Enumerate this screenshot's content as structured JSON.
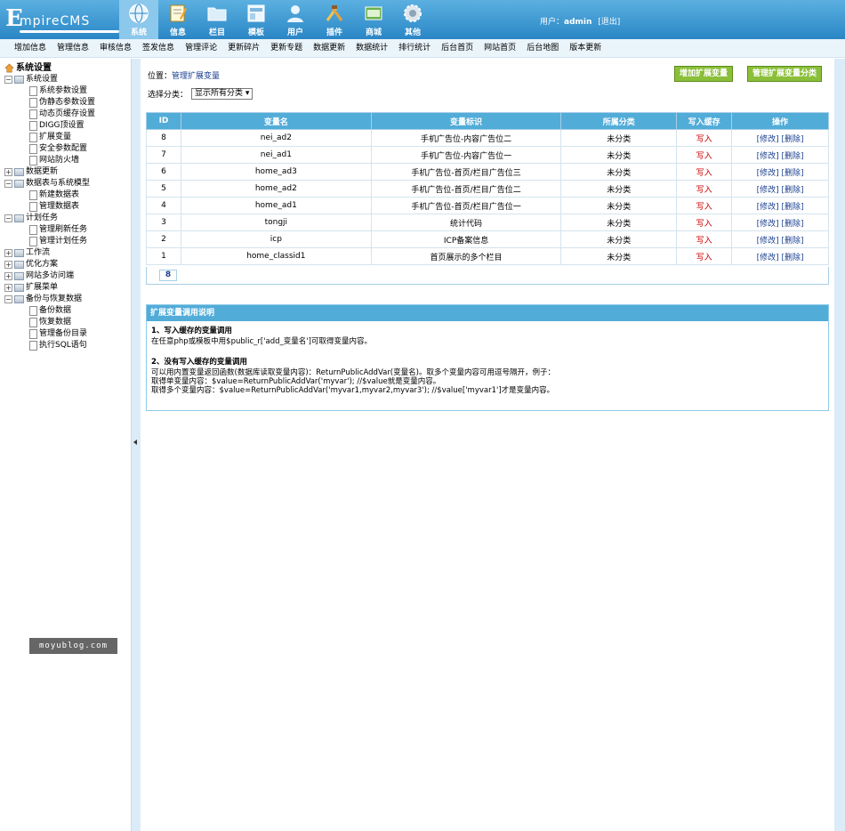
{
  "brand": {
    "logo_first": "E",
    "logo_rest": "mpireCMS"
  },
  "topnav": [
    {
      "label": "系统",
      "icon": "globe-icon"
    },
    {
      "label": "信息",
      "icon": "notepad-icon"
    },
    {
      "label": "栏目",
      "icon": "folder-icon"
    },
    {
      "label": "模板",
      "icon": "template-icon"
    },
    {
      "label": "用户",
      "icon": "user-icon"
    },
    {
      "label": "插件",
      "icon": "tools-icon"
    },
    {
      "label": "商城",
      "icon": "shop-icon"
    },
    {
      "label": "其他",
      "icon": "gear-icon"
    }
  ],
  "user": {
    "prefix": "用户：",
    "name": "admin",
    "logout": "[退出]"
  },
  "subnav": [
    "增加信息",
    "管理信息",
    "审核信息",
    "签发信息",
    "管理评论",
    "更新碎片",
    "更新专题",
    "数据更新",
    "数据统计",
    "排行统计",
    "后台首页",
    "网站首页",
    "后台地图",
    "版本更新"
  ],
  "tree": {
    "root": "系统设置",
    "nodes": [
      {
        "label": "系统设置",
        "open": true,
        "children": [
          "系统参数设置",
          "伪静态参数设置",
          "动态页缓存设置",
          "DIGG顶设置",
          "扩展变量",
          "安全参数配置",
          "网站防火墙"
        ]
      },
      {
        "label": "数据更新",
        "open": false,
        "children": []
      },
      {
        "label": "数据表与系统模型",
        "open": true,
        "children": [
          "新建数据表",
          "管理数据表"
        ]
      },
      {
        "label": "计划任务",
        "open": true,
        "children": [
          "管理刷新任务",
          "管理计划任务"
        ]
      },
      {
        "label": "工作流",
        "open": false,
        "children": []
      },
      {
        "label": "优化方案",
        "open": false,
        "children": []
      },
      {
        "label": "网站多访问端",
        "open": false,
        "children": []
      },
      {
        "label": "扩展菜单",
        "open": false,
        "children": []
      },
      {
        "label": "备份与恢复数据",
        "open": true,
        "children": [
          "备份数据",
          "恢复数据",
          "管理备份目录",
          "执行SQL语句"
        ]
      }
    ]
  },
  "watermark": "moyublog.com",
  "main": {
    "crumb_prefix": "位置：",
    "crumb_link": "管理扩展变量",
    "btn_add": "增加扩展变量",
    "btn_manage_class": "管理扩展变量分类",
    "filter_label": "选择分类：",
    "filter_value": "显示所有分类 ▾",
    "table": {
      "headers": [
        "ID",
        "变量名",
        "变量标识",
        "所属分类",
        "写入缓存",
        "操作"
      ],
      "rows": [
        [
          "8",
          "nei_ad2",
          "手机广告位-内容广告位二",
          "未分类",
          "写入",
          "[修改] [删除]"
        ],
        [
          "7",
          "nei_ad1",
          "手机广告位-内容广告位一",
          "未分类",
          "写入",
          "[修改] [删除]"
        ],
        [
          "6",
          "home_ad3",
          "手机广告位-首页/栏目广告位三",
          "未分类",
          "写入",
          "[修改] [删除]"
        ],
        [
          "5",
          "home_ad2",
          "手机广告位-首页/栏目广告位二",
          "未分类",
          "写入",
          "[修改] [删除]"
        ],
        [
          "4",
          "home_ad1",
          "手机广告位-首页/栏目广告位一",
          "未分类",
          "写入",
          "[修改] [删除]"
        ],
        [
          "3",
          "tongji",
          "统计代码",
          "未分类",
          "写入",
          "[修改] [删除]"
        ],
        [
          "2",
          "icp",
          "ICP备案信息",
          "未分类",
          "写入",
          "[修改] [删除]"
        ],
        [
          "1",
          "home_classid1",
          "首页展示的多个栏目",
          "未分类",
          "写入",
          "[修改] [删除]"
        ]
      ]
    },
    "pager": "8",
    "help": {
      "title": "扩展变量调用说明",
      "s1_title": "1、写入缓存的变量调用",
      "s1_text": "在任意php或模板中用$public_r['add_变量名']可取得变量内容。",
      "s2_title": "2、没有写入缓存的变量调用",
      "s2_line1": "可以用内置变量返回函数(数据库读取变量内容)：ReturnPublicAddVar(变量名)。取多个变量内容可用逗号隔开，例子：",
      "s2_line2": "取得单变量内容：$value=ReturnPublicAddVar('myvar'); //$value就是变量内容。",
      "s2_line3": "取得多个变量内容：$value=ReturnPublicAddVar('myvar1,myvar2,myvar3'); //$value['myvar1']才是变量内容。"
    }
  },
  "colors": {
    "header_blue": "#2a86c6",
    "table_head": "#52acd8",
    "green_button": "#8bbf3a",
    "write_red": "#cc0000"
  }
}
